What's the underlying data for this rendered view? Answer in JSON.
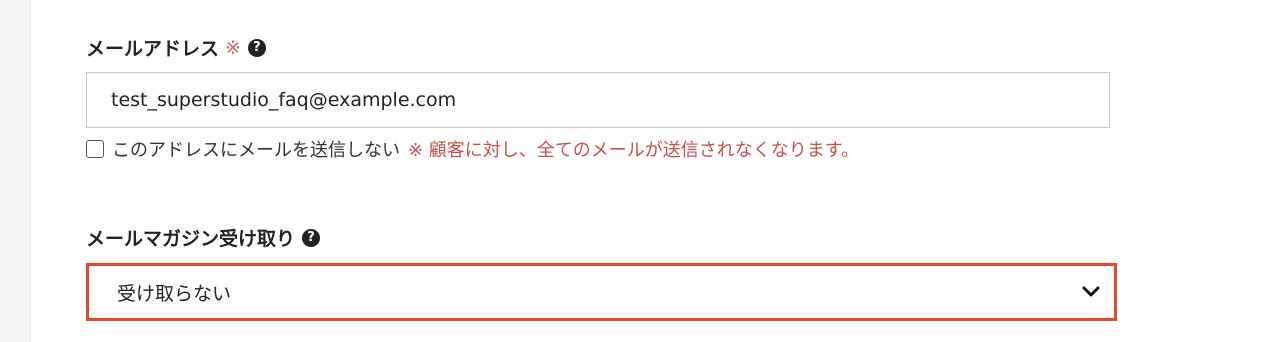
{
  "email_field": {
    "label": "メールアドレス",
    "required_mark": "※",
    "value": "test_superstudio_faq@example.com",
    "no_send_checkbox": {
      "label": "このアドレスにメールを送信しない",
      "note": "※ 顧客に対し、全てのメールが送信されなくなります。",
      "checked": false
    }
  },
  "newsletter_field": {
    "label": "メールマガジン受け取り",
    "selected": "受け取らない"
  },
  "icons": {
    "help": "question-circle-icon",
    "dropdown": "chevron-down-icon"
  },
  "colors": {
    "required": "#d46363",
    "highlight_border": "#e34a2d"
  }
}
